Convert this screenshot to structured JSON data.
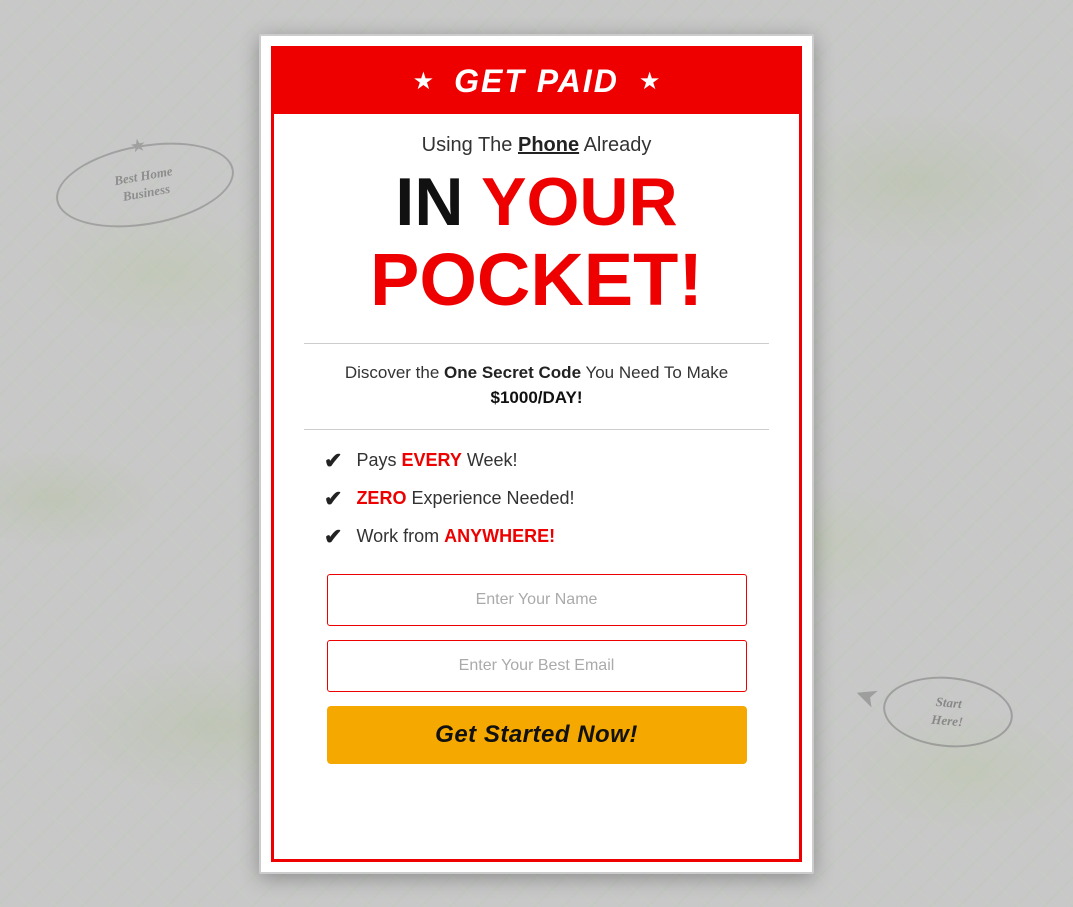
{
  "background": {
    "stamp_left_line1": "Best Home",
    "stamp_left_line2": "Business"
  },
  "card": {
    "header": {
      "title": "GET PAID",
      "star_left": "★",
      "star_right": "★"
    },
    "subtitle": {
      "prefix": "Using The ",
      "phone": "Phone",
      "suffix": " Already"
    },
    "headline": {
      "in": "IN",
      "your": " YOUR",
      "pocket": "POCKET!"
    },
    "discover": {
      "prefix": "Discover the ",
      "bold": "One Secret Code",
      "suffix": " You Need To Make ",
      "amount": "$1000/DAY!"
    },
    "checklist": [
      {
        "highlight": "EVERY",
        "prefix": "Pays ",
        "suffix": " Week!"
      },
      {
        "highlight": "ZERO",
        "prefix": "",
        "suffix": " Experience Needed!"
      },
      {
        "highlight": "ANYWHERE!",
        "prefix": "Work from ",
        "suffix": ""
      }
    ],
    "form": {
      "name_placeholder": "Enter Your Name",
      "email_placeholder": "Enter Your Best Email",
      "cta_label": "Get Started Now!"
    }
  },
  "stamps": {
    "left": "Best Home\nBusiness",
    "right": "Start\nHere!"
  }
}
